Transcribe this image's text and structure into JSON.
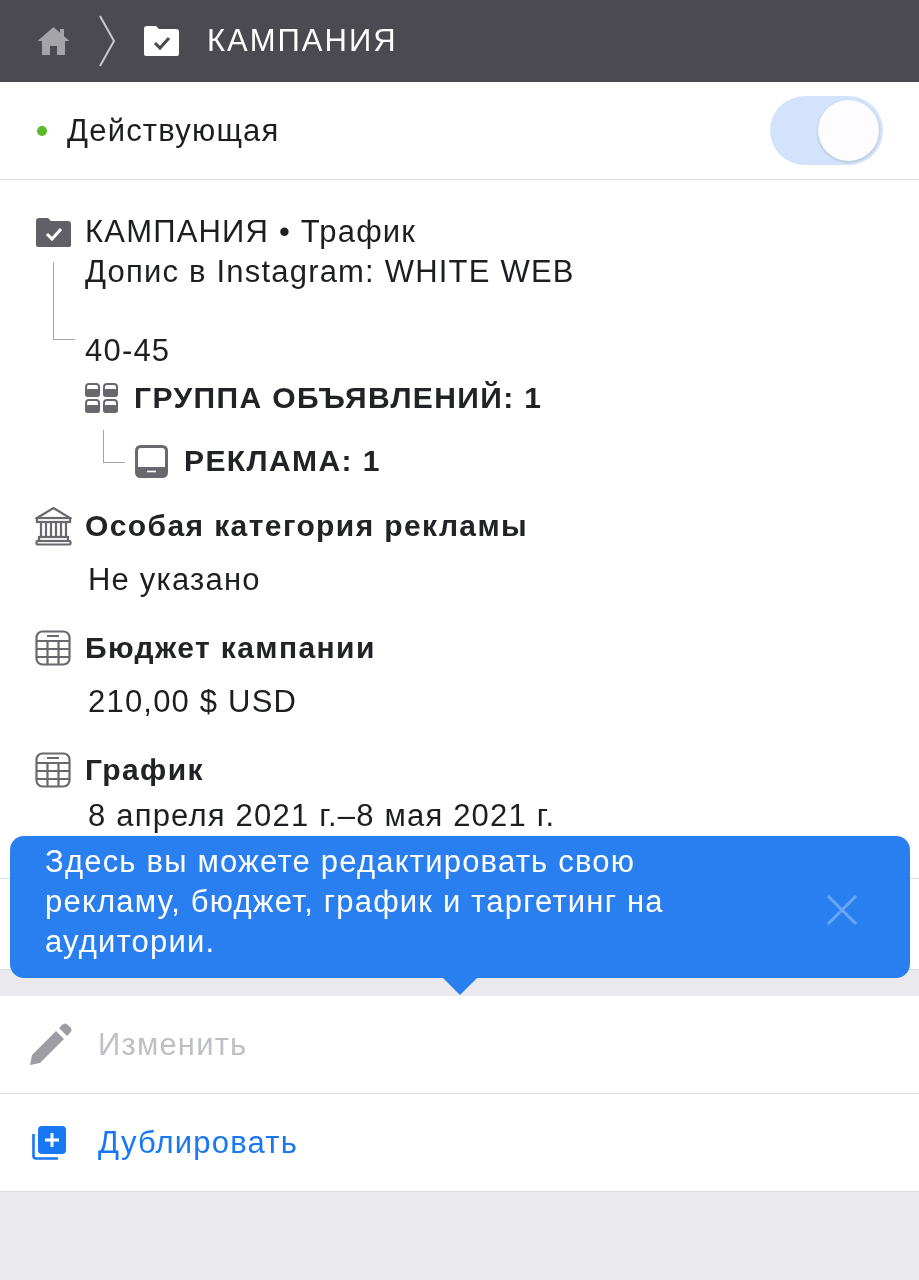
{
  "header": {
    "title": "КАМПАНИЯ"
  },
  "status": {
    "label": "Действующая",
    "toggle": {
      "on": true,
      "disabled": true
    }
  },
  "campaign": {
    "title": "КАМПАНИЯ • Трафик",
    "name": "Допис в Instagram: WHITE WEB",
    "children": [
      {
        "name": "40-45",
        "label": "ГРУППА ОБЪЯВЛЕНИЙ: 1",
        "children": [
          {
            "label": "РЕКЛАМА: 1"
          }
        ]
      }
    ]
  },
  "sections": [
    {
      "kind": "category",
      "title": "Особая категория рекламы",
      "value": "Не указано"
    },
    {
      "kind": "budget",
      "title": "Бюджет кампании",
      "value": "210,00 $ USD"
    },
    {
      "kind": "schedule",
      "title": "График",
      "value": "8 апреля 2021 г.–8 мая 2021 г."
    }
  ],
  "tooltip": {
    "text": "Здесь вы можете редактировать свою рекламу, бюджет, график и таргетинг на аудитории."
  },
  "actions": [
    {
      "kind": "edit",
      "label": "Изменить",
      "disabled": true
    },
    {
      "kind": "duplicate",
      "label": "Дублировать",
      "disabled": false
    }
  ]
}
